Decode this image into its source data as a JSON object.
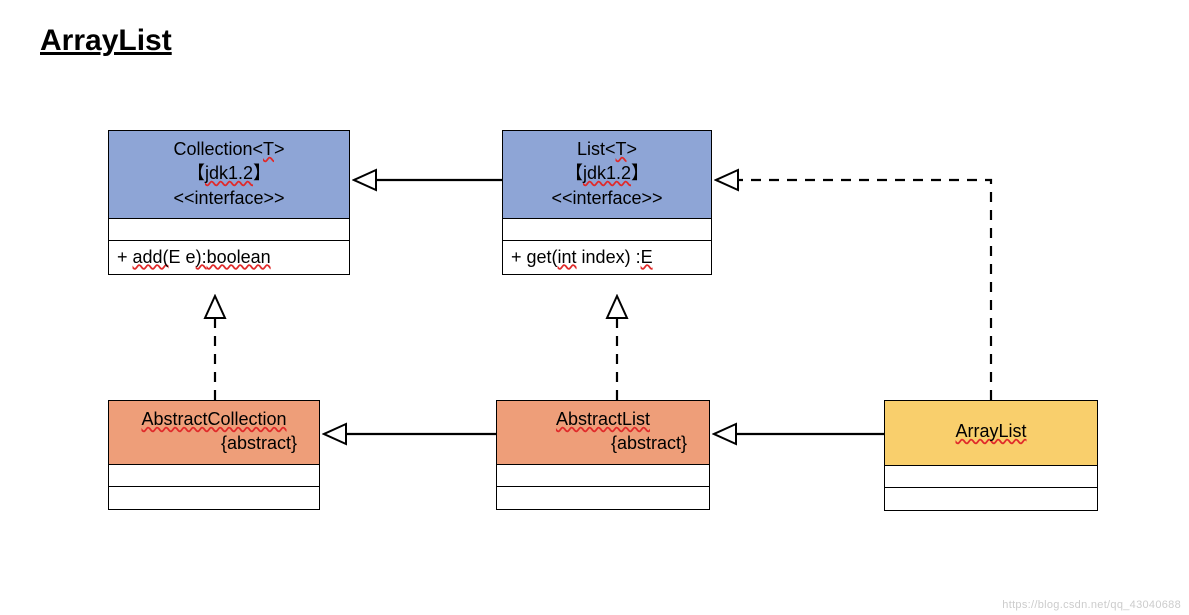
{
  "title": "ArrayList",
  "watermark": "https://blog.csdn.net/qq_43040688",
  "boxes": {
    "collection": {
      "name_pre": "Collection<",
      "generic": "T",
      "name_post": ">",
      "jdk_open": "【",
      "jdk_text": "jdk1.2",
      "jdk_close": "】",
      "stereotype": "<<interface>>",
      "method_pre": "+ ",
      "method_name": "add(",
      "method_arg": "E e",
      "method_mid": "):",
      "method_ret": "boolean"
    },
    "list": {
      "name_pre": "List<",
      "generic": "T",
      "name_post": ">",
      "jdk_open": "【",
      "jdk_text": "jdk1.2",
      "jdk_close": "】",
      "stereotype": "<<interface>>",
      "method_pre": "+ get(",
      "method_arg": "int",
      "method_mid": " index) :",
      "method_ret": "E"
    },
    "abstractCollection": {
      "name": "AbstractCollection",
      "qualifier": "{abstract}"
    },
    "abstractList": {
      "name": "AbstractList",
      "qualifier": "{abstract}"
    },
    "arrayList": {
      "name": "ArrayList"
    }
  },
  "chart_data": {
    "type": "table",
    "description": "UML class diagram for ArrayList hierarchy",
    "nodes": [
      {
        "id": "Collection<T>",
        "stereotype": "interface",
        "since": "jdk1.2",
        "methods": [
          "+ add(E e):boolean"
        ]
      },
      {
        "id": "List<T>",
        "stereotype": "interface",
        "since": "jdk1.2",
        "methods": [
          "+ get(int index) :E"
        ]
      },
      {
        "id": "AbstractCollection",
        "stereotype": "abstract"
      },
      {
        "id": "AbstractList",
        "stereotype": "abstract"
      },
      {
        "id": "ArrayList",
        "stereotype": "class"
      }
    ],
    "edges": [
      {
        "from": "List<T>",
        "to": "Collection<T>",
        "type": "extends",
        "style": "solid"
      },
      {
        "from": "AbstractCollection",
        "to": "Collection<T>",
        "type": "implements",
        "style": "dashed"
      },
      {
        "from": "AbstractList",
        "to": "List<T>",
        "type": "implements",
        "style": "dashed"
      },
      {
        "from": "AbstractList",
        "to": "AbstractCollection",
        "type": "extends",
        "style": "solid"
      },
      {
        "from": "ArrayList",
        "to": "AbstractList",
        "type": "extends",
        "style": "solid"
      },
      {
        "from": "ArrayList",
        "to": "List<T>",
        "type": "implements",
        "style": "dashed"
      }
    ]
  }
}
